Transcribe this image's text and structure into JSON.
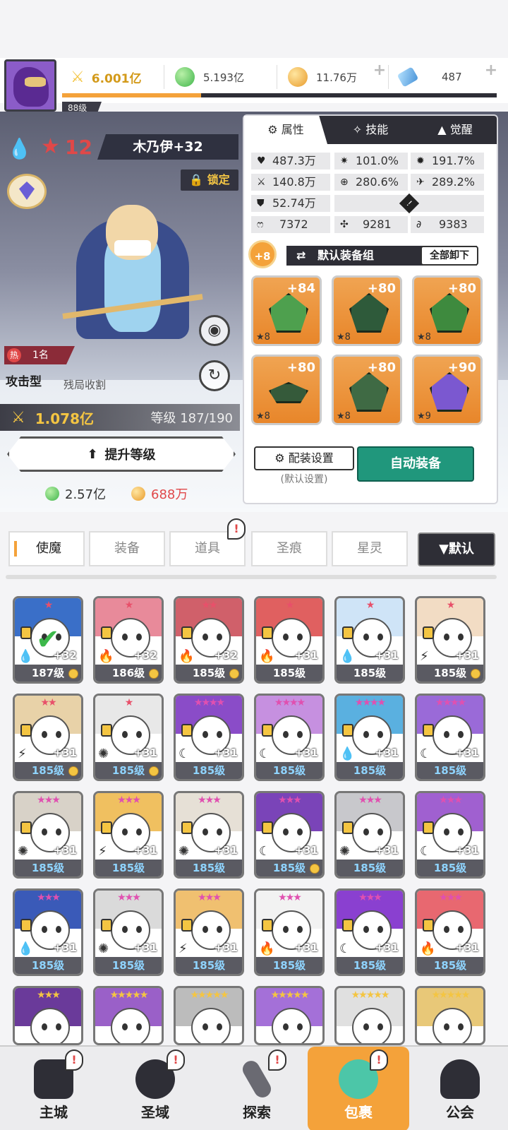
{
  "player": {
    "level": "88级"
  },
  "resources": [
    {
      "name": "power",
      "value": "6.001亿",
      "icon": "swords-icon",
      "color": "#f4c542"
    },
    {
      "name": "green_gem",
      "value": "5.193亿",
      "icon": "green-orb-icon",
      "color": "#59c95e"
    },
    {
      "name": "gold",
      "value": "11.76万",
      "icon": "gold-coin-icon",
      "color": "#f0b34a"
    },
    {
      "name": "crystal",
      "value": "487",
      "icon": "blue-crystal-icon",
      "color": "#5aa8e6"
    }
  ],
  "xp_progress": 0.32,
  "hero": {
    "star_level": "12",
    "name": "木乃伊+32",
    "lock_label": "锁定",
    "rank_label": "1名",
    "hot_label": "热",
    "type": "攻击型",
    "trait": "残局收割",
    "power": "1.078亿",
    "level_label": "等级 187/190",
    "upgrade_label": "提升等级",
    "cost_green": "2.57亿",
    "cost_gold": "688万"
  },
  "panel": {
    "tabs": [
      {
        "label": "属性",
        "icon": "attribute-icon"
      },
      {
        "label": "技能",
        "icon": "skill-icon"
      },
      {
        "label": "觉醒",
        "icon": "awaken-icon"
      }
    ],
    "stats": {
      "hp": "487.3万",
      "crit_rate": "101.0%",
      "crit_dmg": "191.7%",
      "atk": "140.8万",
      "accuracy": "280.6%",
      "speed": "289.2%",
      "def": "52.74万",
      "s1": "7372",
      "s2": "9281",
      "s3": "9383"
    },
    "set_bonus": "+8",
    "set_label": "默认装备组",
    "unload_label": "全部卸下",
    "equipment": [
      {
        "plus": "+84",
        "stars": "★8",
        "icon": "sword-equip-icon"
      },
      {
        "plus": "+80",
        "stars": "★8",
        "icon": "helmet-equip-icon"
      },
      {
        "plus": "+80",
        "stars": "★8",
        "icon": "armor-equip-icon"
      },
      {
        "plus": "+80",
        "stars": "★8",
        "icon": "belt-equip-icon"
      },
      {
        "plus": "+80",
        "stars": "★8",
        "icon": "crown-equip-icon"
      },
      {
        "plus": "+90",
        "stars": "★9",
        "icon": "boots-equip-icon"
      }
    ],
    "config_label": "配装设置",
    "config_sub": "(默认设置)",
    "auto_label": "自动装备"
  },
  "categories": [
    "使魔",
    "装备",
    "道具",
    "圣痕",
    "星灵"
  ],
  "sort_label": "▼默认",
  "grid": [
    {
      "lv": "187级",
      "plus": "+32",
      "stars": "★",
      "el": "💧",
      "coin": true,
      "blue": false,
      "check": true,
      "color": "#3a6fc8"
    },
    {
      "lv": "186级",
      "plus": "+32",
      "stars": "★",
      "el": "🔥",
      "coin": true,
      "blue": false,
      "check": false,
      "color": "#e88a9a"
    },
    {
      "lv": "185级",
      "plus": "+32",
      "stars": "★★",
      "el": "🔥",
      "coin": true,
      "blue": false,
      "check": false,
      "color": "#d0606a"
    },
    {
      "lv": "185级",
      "plus": "+31",
      "stars": "★",
      "el": "🔥",
      "coin": false,
      "blue": false,
      "check": false,
      "color": "#e06060"
    },
    {
      "lv": "185级",
      "plus": "+31",
      "stars": "★",
      "el": "💧",
      "coin": false,
      "blue": false,
      "check": false,
      "color": "#cfe4f7"
    },
    {
      "lv": "185级",
      "plus": "+31",
      "stars": "★",
      "el": "⚡",
      "coin": true,
      "blue": false,
      "check": false,
      "color": "#f2dcc4"
    },
    {
      "lv": "185级",
      "plus": "+31",
      "stars": "★★",
      "el": "⚡",
      "coin": true,
      "blue": true,
      "check": false,
      "color": "#e8d2a8"
    },
    {
      "lv": "185级",
      "plus": "+31",
      "stars": "★",
      "el": "✺",
      "coin": true,
      "blue": true,
      "check": false,
      "color": "#e8e8e8"
    },
    {
      "lv": "185级",
      "plus": "+31",
      "stars": "★★★★",
      "el": "☾",
      "coin": false,
      "blue": true,
      "check": false,
      "color": "#8a4cc8"
    },
    {
      "lv": "185级",
      "plus": "+31",
      "stars": "★★★★",
      "el": "☾",
      "coin": false,
      "blue": true,
      "check": false,
      "color": "#c690e0"
    },
    {
      "lv": "185级",
      "plus": "+31",
      "stars": "★★★★",
      "el": "💧",
      "coin": false,
      "blue": true,
      "check": false,
      "color": "#5ab0e0"
    },
    {
      "lv": "185级",
      "plus": "+31",
      "stars": "★★★★",
      "el": "☾",
      "coin": false,
      "blue": true,
      "check": false,
      "color": "#9a6ad8"
    },
    {
      "lv": "185级",
      "plus": "+31",
      "stars": "★★★",
      "el": "✺",
      "coin": false,
      "blue": true,
      "check": false,
      "color": "#d8d2c8"
    },
    {
      "lv": "185级",
      "plus": "+31",
      "stars": "★★★",
      "el": "⚡",
      "coin": false,
      "blue": true,
      "check": false,
      "color": "#f0c060"
    },
    {
      "lv": "185级",
      "plus": "+31",
      "stars": "★★★",
      "el": "✺",
      "coin": false,
      "blue": true,
      "check": false,
      "color": "#e6e0d6"
    },
    {
      "lv": "185级",
      "plus": "+31",
      "stars": "★★★",
      "el": "☾",
      "coin": true,
      "blue": true,
      "check": false,
      "color": "#7a44b8"
    },
    {
      "lv": "185级",
      "plus": "+31",
      "stars": "★★★",
      "el": "✺",
      "coin": false,
      "blue": true,
      "check": false,
      "color": "#c8c8cc"
    },
    {
      "lv": "185级",
      "plus": "+31",
      "stars": "★★★",
      "el": "☾",
      "coin": false,
      "blue": true,
      "check": false,
      "color": "#a060d0"
    },
    {
      "lv": "185级",
      "plus": "+31",
      "stars": "★★★",
      "el": "💧",
      "coin": false,
      "blue": true,
      "check": false,
      "color": "#3a5ab8"
    },
    {
      "lv": "185级",
      "plus": "+31",
      "stars": "★★★",
      "el": "✺",
      "coin": false,
      "blue": true,
      "check": false,
      "color": "#dadada"
    },
    {
      "lv": "185级",
      "plus": "+31",
      "stars": "★★★",
      "el": "⚡",
      "coin": false,
      "blue": true,
      "check": false,
      "color": "#f0c070"
    },
    {
      "lv": "185级",
      "plus": "+31",
      "stars": "★★★",
      "el": "🔥",
      "coin": false,
      "blue": true,
      "check": false,
      "color": "#f2f2f2"
    },
    {
      "lv": "185级",
      "plus": "+31",
      "stars": "★★★",
      "el": "☾",
      "coin": false,
      "blue": true,
      "check": false,
      "color": "#8a40d0"
    },
    {
      "lv": "185级",
      "plus": "+31",
      "stars": "★★★",
      "el": "🔥",
      "coin": false,
      "blue": true,
      "check": false,
      "color": "#e86870"
    },
    {
      "lv": "",
      "plus": "",
      "stars": "★★★",
      "el": "",
      "coin": false,
      "blue": true,
      "check": false,
      "color": "#6a3a9a"
    },
    {
      "lv": "",
      "plus": "",
      "stars": "★★★★★",
      "el": "",
      "coin": false,
      "blue": true,
      "check": false,
      "color": "#9a60c8"
    },
    {
      "lv": "",
      "plus": "",
      "stars": "★★★★★",
      "el": "",
      "coin": false,
      "blue": true,
      "check": false,
      "color": "#bcbcbc"
    },
    {
      "lv": "",
      "plus": "",
      "stars": "★★★★★",
      "el": "",
      "coin": false,
      "blue": true,
      "check": false,
      "color": "#a470d8"
    },
    {
      "lv": "",
      "plus": "",
      "stars": "★★★★★",
      "el": "",
      "coin": false,
      "blue": true,
      "check": false,
      "color": "#e0e0e0"
    },
    {
      "lv": "",
      "plus": "",
      "stars": "★★★★★",
      "el": "",
      "coin": false,
      "blue": true,
      "check": false,
      "color": "#e8c878"
    }
  ],
  "nav": [
    {
      "label": "主城",
      "icon": "castle-icon",
      "badge": "!"
    },
    {
      "label": "圣域",
      "icon": "vortex-icon",
      "badge": "!"
    },
    {
      "label": "探索",
      "icon": "sword-explore-icon",
      "badge": "!"
    },
    {
      "label": "包裹",
      "icon": "bag-icon",
      "badge": "!"
    },
    {
      "label": "公会",
      "icon": "guild-helmet-icon",
      "badge": ""
    }
  ],
  "alert_mark": "!"
}
